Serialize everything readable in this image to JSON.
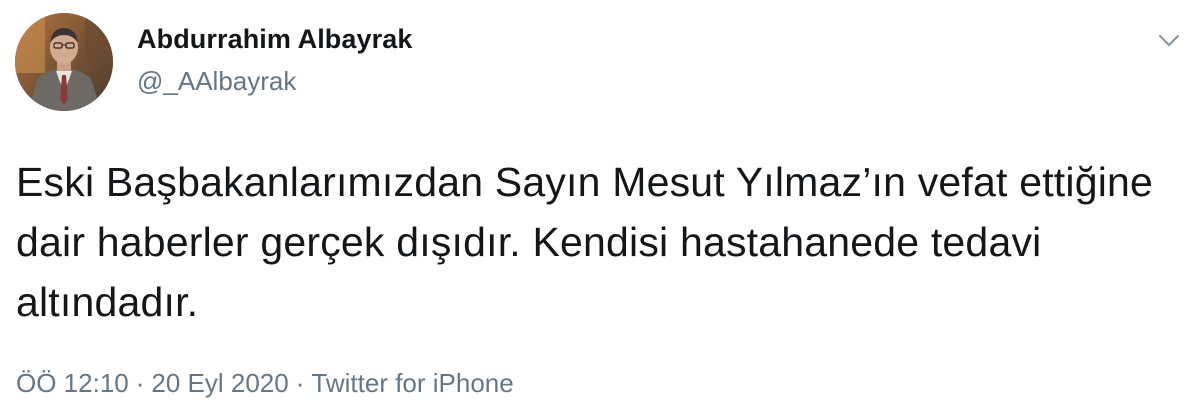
{
  "tweet": {
    "author": {
      "display_name": "Abdurrahim Albayrak",
      "handle": "@_AAlbayrak"
    },
    "text": "Eski Başbakanlarımızdan Sayın Mesut Yılmaz’ın vefat ettiğine dair haberler gerçek dışıdır. Kendisi hastahanede tedavi altındadır.",
    "time": "ÖÖ 12:10",
    "date": "20 Eyl 2020",
    "separator": "·",
    "source": "Twitter for iPhone"
  },
  "icons": {
    "menu": "chevron-down-icon"
  },
  "colors": {
    "text_primary": "#14171a",
    "text_secondary": "#657786",
    "background": "#ffffff"
  }
}
